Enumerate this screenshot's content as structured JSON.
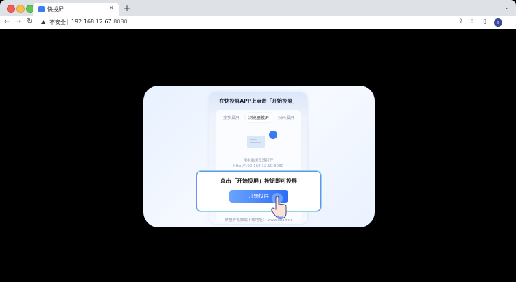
{
  "browser": {
    "tab_title": "快投屏",
    "tab_close": "×",
    "new_tab": "+",
    "security_warning": "不安全",
    "url_host": "192.168.12.67",
    "url_port": ":8080",
    "profile_initial": "T"
  },
  "page": {
    "phone_title": "在快投屏APP上点击「开始投屏」",
    "segments": [
      "搜索投屏",
      "浏览器投屏",
      "扫码投屏"
    ],
    "instruction": "用电脑浏览器打开",
    "instruction_url": "http://192.168.12.10:8080",
    "footer": "快投屏电脑端下载地址：   www.kuaitou",
    "popup_text": "点击「开始投屏」按钮即可投屏",
    "popup_button": "开始投屏"
  },
  "colors": {
    "accent": "#2e6cf6",
    "background": "#000000"
  }
}
